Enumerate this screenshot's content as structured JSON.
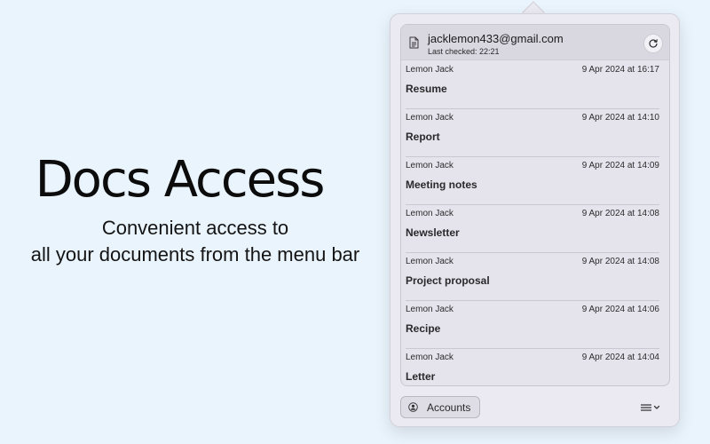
{
  "hero": {
    "title": "Docs Access",
    "subtitle_line1": "Convenient access to",
    "subtitle_line2": "all your documents from the menu bar"
  },
  "account": {
    "email": "jacklemon433@gmail.com",
    "last_checked": "Last checked: 22:21",
    "document_icon": "document-icon",
    "refresh_icon": "refresh-icon"
  },
  "documents": [
    {
      "author": "Lemon Jack",
      "date": "9 Apr 2024 at 16:17",
      "name": "Resume"
    },
    {
      "author": "Lemon Jack",
      "date": "9 Apr 2024 at 14:10",
      "name": "Report"
    },
    {
      "author": "Lemon Jack",
      "date": "9 Apr 2024 at 14:09",
      "name": "Meeting notes"
    },
    {
      "author": "Lemon Jack",
      "date": "9 Apr 2024 at 14:08",
      "name": "Newsletter"
    },
    {
      "author": "Lemon Jack",
      "date": "9 Apr 2024 at 14:08",
      "name": "Project proposal"
    },
    {
      "author": "Lemon Jack",
      "date": "9 Apr 2024 at 14:06",
      "name": "Recipe"
    },
    {
      "author": "Lemon Jack",
      "date": "9 Apr 2024 at 14:04",
      "name": "Letter"
    }
  ],
  "footer": {
    "accounts_label": "Accounts",
    "accounts_icon": "person-circle-icon",
    "menu_icon": "list-menu-icon"
  },
  "colors": {
    "background": "#eaf4fd",
    "popover": "#ebe9f1",
    "header": "#d9d7e0"
  }
}
